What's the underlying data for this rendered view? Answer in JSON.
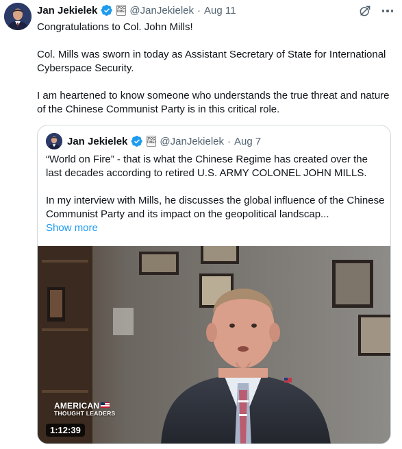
{
  "tweet": {
    "name": "Jan Jekielek",
    "handle": "@JanJekielek",
    "separator": "·",
    "date": "Aug 11",
    "affiliate_badge": "EPOCH TIMES",
    "paragraphs": [
      "Congratulations to Col. John Mills!",
      "Col. Mills was sworn in today as Assistant Secretary of State for International Cyberspace Security.",
      "I am heartened to know someone who understands the true threat and nature of the Chinese Communist Party is in this critical role."
    ]
  },
  "quoted": {
    "name": "Jan Jekielek",
    "handle": "@JanJekielek",
    "separator": "·",
    "date": "Aug 7",
    "paragraphs": [
      "“World on Fire” - that is what the Chinese Regime has created over the last decades according to retired U.S. ARMY COLONEL JOHN MILLS.",
      "In my interview with Mills, he discusses the global influence of the Chinese Communist Party and its impact on the geopolitical landscap..."
    ],
    "show_more": "Show more",
    "video": {
      "brand_line1": "AMERICAN",
      "brand_line2": "THOUGHT LEADERS",
      "duration": "1:12:39"
    }
  },
  "icons": {
    "verified": "verified-badge-icon",
    "grok": "grok-icon",
    "more": "more-options-icon"
  },
  "colors": {
    "accent": "#1d9bf0",
    "secondary_text": "#536471",
    "border": "#cfd9de"
  }
}
